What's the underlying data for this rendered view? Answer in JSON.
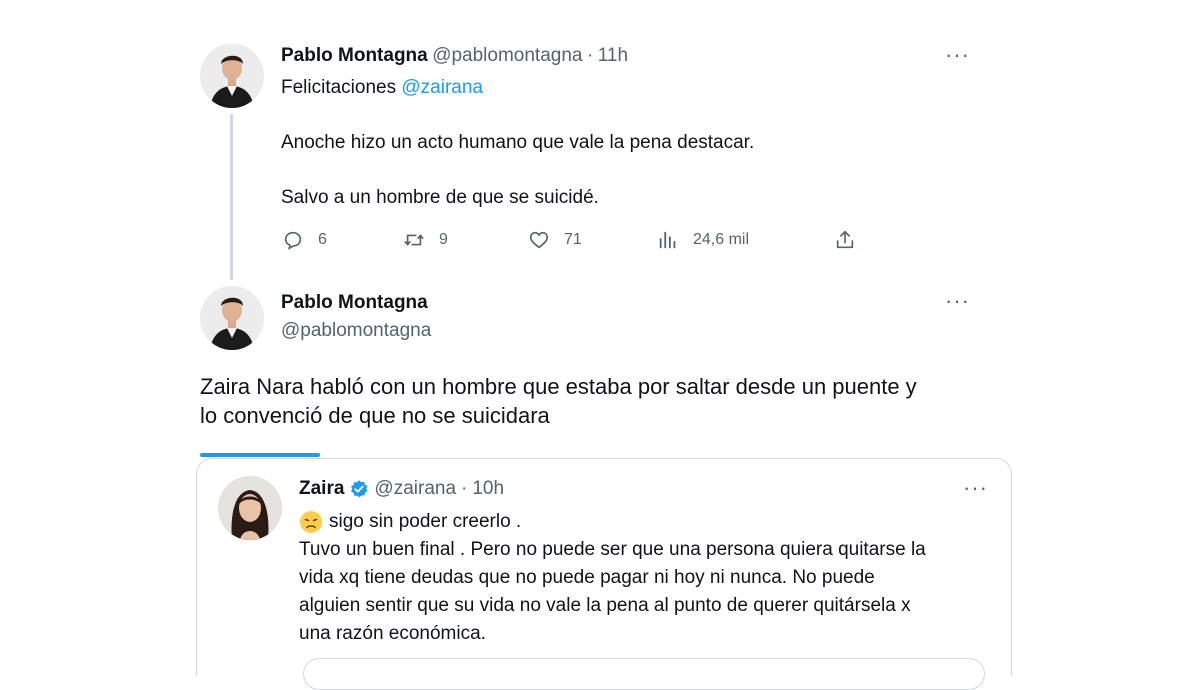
{
  "tweet1": {
    "name": "Pablo Montagna",
    "handle": "@pablomontagna",
    "sep": "·",
    "time": "11h",
    "more": "···",
    "line1_prefix": "Felicitaciones",
    "line1_mention": "@zairana",
    "line2": "Anoche hizo un acto humano que vale la pena destacar.",
    "line3": "Salvo a un hombre de que se suicidé.",
    "actions": {
      "replies": "6",
      "retweets": "9",
      "likes": "71",
      "views": "24,6 mil"
    }
  },
  "tweet2": {
    "name": "Pablo Montagna",
    "handle": "@pablomontagna",
    "more": "···",
    "text_line1": "Zaira Nara habló con un hombre que estaba por saltar desde un puente y",
    "text_line2": "lo convenció de que no se suicidara"
  },
  "quote": {
    "name": "Zaira",
    "handle": "@zairana",
    "sep": "·",
    "time": "10h",
    "more": "···",
    "line1": "sigo sin poder creerlo .",
    "line2": "Tuvo un buen final . Pero no puede ser que una persona quiera quitarse la",
    "line3": "vida xq tiene deudas que no puede pagar ni hoy ni nunca. No puede",
    "line4": "alguien sentir que su vida no vale la pena al punto de querer quitársela x",
    "line5": "una razón económica."
  },
  "icons": {
    "reply": "reply-icon",
    "retweet": "retweet-icon",
    "like": "heart-icon",
    "views": "views-icon",
    "share": "share-icon",
    "verified": "verified-badge-icon",
    "emoji": "disappointed-face-emoji"
  },
  "colors": {
    "accent": "#1d9bf0",
    "text": "#0f1419",
    "muted": "#536471",
    "border": "#cfd9de"
  }
}
